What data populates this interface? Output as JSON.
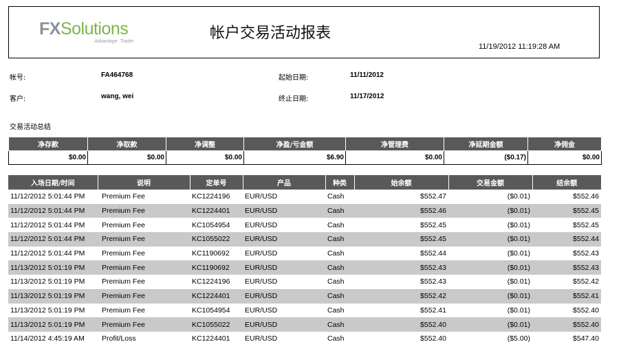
{
  "header": {
    "logo_fx": "FX",
    "logo_solutions": "Solutions",
    "logo_tagline": "Advantage. Trader.",
    "title": "帐户交易活动报表",
    "timestamp": "11/19/2012 11:19:28 AM"
  },
  "info": {
    "account_label": "帐号:",
    "account_value": "FA464768",
    "client_label": "客户:",
    "client_value": "wang, wei",
    "start_label": "起始日期:",
    "start_value": "11/11/2012",
    "end_label": "终止日期:",
    "end_value": "11/17/2012"
  },
  "summary": {
    "title": "交易活动总结",
    "headers": [
      "净存款",
      "净取款",
      "净调整",
      "净盈/亏金额",
      "净管理费",
      "净延期金额",
      "净佣金"
    ],
    "values": [
      "$0.00",
      "$0.00",
      "$0.00",
      "$6.90",
      "$0.00",
      "($0.17)",
      "$0.00"
    ]
  },
  "detail": {
    "headers": [
      "入场日期/时间",
      "说明",
      "定单号",
      "产品",
      "种类",
      "始余额",
      "交易金额",
      "结余额"
    ],
    "rows": [
      [
        "11/12/2012 5:01:44 PM",
        "Premium Fee",
        "KC1224196",
        "EUR/USD",
        "Cash",
        "$552.47",
        "($0.01)",
        "$552.46"
      ],
      [
        "11/12/2012 5:01:44 PM",
        "Premium Fee",
        "KC1224401",
        "EUR/USD",
        "Cash",
        "$552.46",
        "($0.01)",
        "$552.45"
      ],
      [
        "11/12/2012 5:01:44 PM",
        "Premium Fee",
        "KC1054954",
        "EUR/USD",
        "Cash",
        "$552.45",
        "($0.01)",
        "$552.45"
      ],
      [
        "11/12/2012 5:01:44 PM",
        "Premium Fee",
        "KC1055022",
        "EUR/USD",
        "Cash",
        "$552.45",
        "($0.01)",
        "$552.44"
      ],
      [
        "11/12/2012 5:01:44 PM",
        "Premium Fee",
        "KC1190692",
        "EUR/USD",
        "Cash",
        "$552.44",
        "($0.01)",
        "$552.43"
      ],
      [
        "11/13/2012 5:01:19 PM",
        "Premium Fee",
        "KC1190692",
        "EUR/USD",
        "Cash",
        "$552.43",
        "($0.01)",
        "$552.43"
      ],
      [
        "11/13/2012 5:01:19 PM",
        "Premium Fee",
        "KC1224196",
        "EUR/USD",
        "Cash",
        "$552.43",
        "($0.01)",
        "$552.42"
      ],
      [
        "11/13/2012 5:01:19 PM",
        "Premium Fee",
        "KC1224401",
        "EUR/USD",
        "Cash",
        "$552.42",
        "($0.01)",
        "$552.41"
      ],
      [
        "11/13/2012 5:01:19 PM",
        "Premium Fee",
        "KC1054954",
        "EUR/USD",
        "Cash",
        "$552.41",
        "($0.01)",
        "$552.40"
      ],
      [
        "11/13/2012 5:01:19 PM",
        "Premium Fee",
        "KC1055022",
        "EUR/USD",
        "Cash",
        "$552.40",
        "($0.01)",
        "$552.40"
      ],
      [
        "11/14/2012 4:45:19 AM",
        "Profit/Loss",
        "KC1224401",
        "EUR/USD",
        "Cash",
        "$552.40",
        "($5.00)",
        "$547.40"
      ]
    ]
  }
}
